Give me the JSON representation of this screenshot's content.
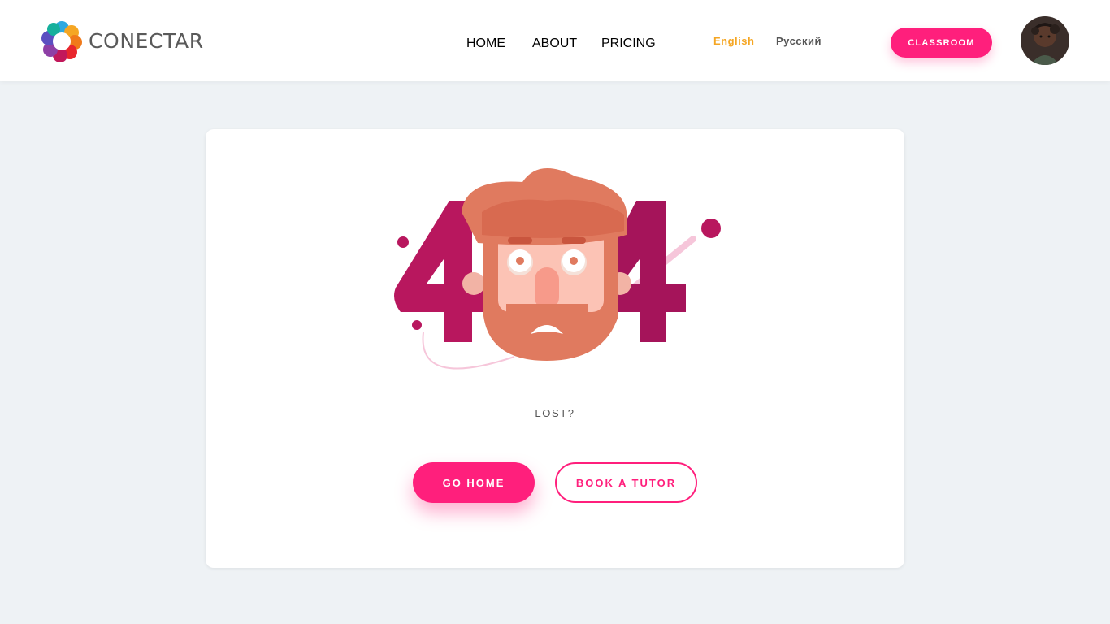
{
  "brand": {
    "name": "CONECTAR"
  },
  "nav": {
    "items": [
      {
        "label": "HOME"
      },
      {
        "label": "ABOUT"
      },
      {
        "label": "PRICING"
      }
    ]
  },
  "languages": [
    {
      "label": "English",
      "active": true
    },
    {
      "label": "Русский",
      "active": false
    }
  ],
  "header": {
    "classroom_label": "CLASSROOM"
  },
  "error": {
    "code": "404",
    "message": "LOST?",
    "go_home_label": "GO HOME",
    "book_tutor_label": "BOOK A TUTOR"
  },
  "colors": {
    "accent": "#ff1f7c",
    "active_language": "#f5a623",
    "numeral": "#b8175e",
    "face": "#e07a5f",
    "background": "#eef2f5"
  }
}
